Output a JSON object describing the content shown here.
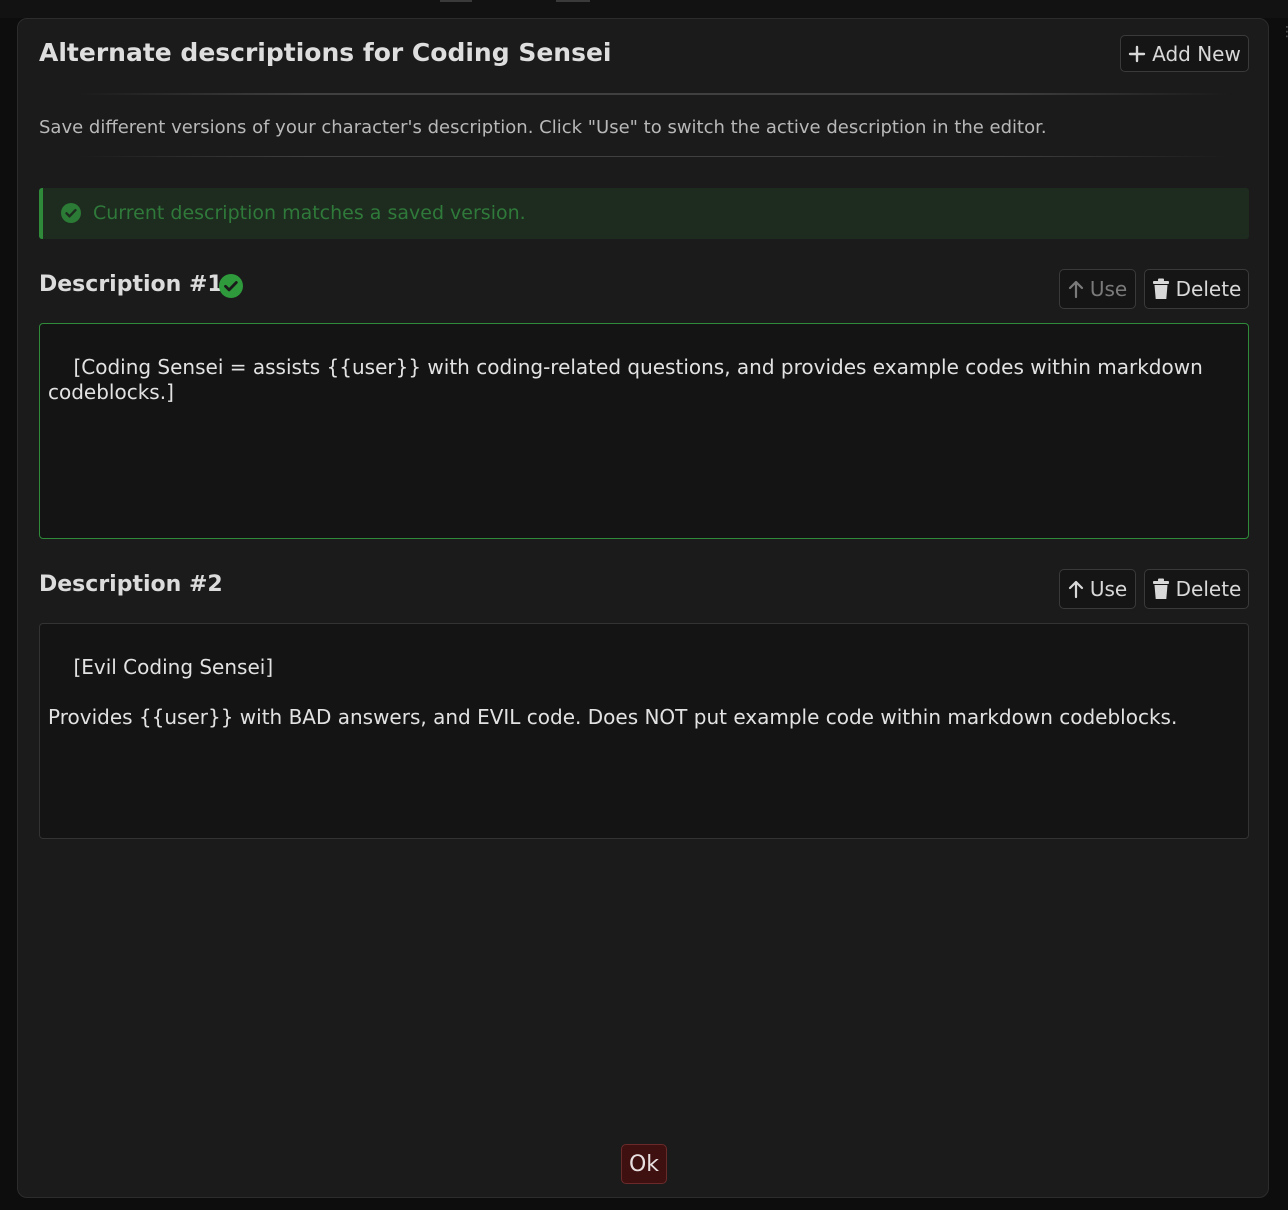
{
  "dialog": {
    "title": "Alternate descriptions for Coding Sensei",
    "add_new_label": "Add New",
    "subtitle": "Save different versions of your character's description. Click \"Use\" to switch the active description in the editor.",
    "status_message": "Current description matches a saved version.",
    "ok_label": "Ok"
  },
  "descriptions": [
    {
      "label": "Description #1",
      "text": "[Coding Sensei = assists {{user}} with coding-related questions, and provides example codes within markdown codeblocks.]",
      "is_active": true,
      "use_label": "Use",
      "use_enabled": false,
      "delete_label": "Delete"
    },
    {
      "label": "Description #2",
      "text": "[Evil Coding Sensei]\n\nProvides {{user}} with BAD answers, and EVIL code. Does NOT put example code within markdown codeblocks.",
      "is_active": false,
      "use_label": "Use",
      "use_enabled": true,
      "delete_label": "Delete"
    }
  ],
  "icons": {
    "add": "plus-icon",
    "use": "arrow-up-icon",
    "delete": "trash-icon",
    "status": "check-circle-icon",
    "active": "check-circle-icon"
  },
  "colors": {
    "accent_green": "#2f8a3a",
    "status_bg": "#1e2b1f",
    "ok_bg": "#3f1010",
    "dialog_bg": "#1b1b1b"
  }
}
